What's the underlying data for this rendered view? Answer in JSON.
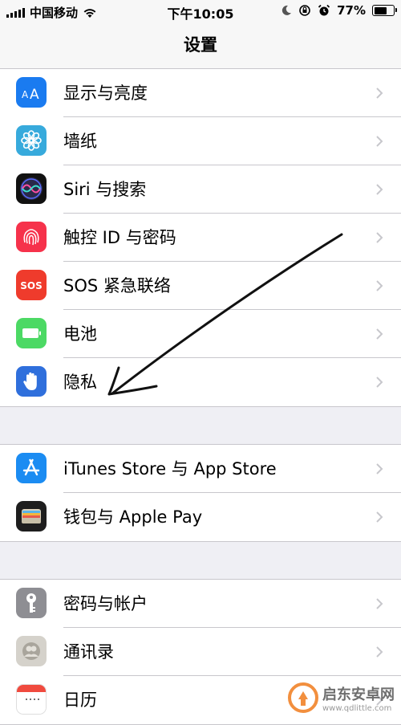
{
  "status_bar": {
    "carrier": "中国移动",
    "time": "下午10:05",
    "battery_percent": "77%",
    "battery_level": 0.77
  },
  "nav": {
    "title": "设置"
  },
  "groups": [
    [
      {
        "label": "显示与亮度",
        "icon": "display-brightness-icon",
        "color": "#1a7bf0"
      },
      {
        "label": "墙纸",
        "icon": "wallpaper-icon",
        "color": "#37aadc"
      },
      {
        "label": "Siri 与搜索",
        "icon": "siri-icon",
        "color": "#1c1c2e"
      },
      {
        "label": "触控 ID 与密码",
        "icon": "fingerprint-icon",
        "color": "#f6324b"
      },
      {
        "label": "SOS 紧急联络",
        "icon": "sos-icon",
        "color": "#ef3b2c",
        "icon_text": "SOS"
      },
      {
        "label": "电池",
        "icon": "battery-icon",
        "color": "#4cd964"
      },
      {
        "label": "隐私",
        "icon": "privacy-hand-icon",
        "color": "#2f6fdc"
      }
    ],
    [
      {
        "label": "iTunes Store 与 App Store",
        "icon": "app-store-icon",
        "color": "#1b8cf2"
      },
      {
        "label": "钱包与 Apple Pay",
        "icon": "wallet-icon",
        "color": "#1e1e1e"
      }
    ],
    [
      {
        "label": "密码与帐户",
        "icon": "key-icon",
        "color": "#8e8e93"
      },
      {
        "label": "通讯录",
        "icon": "contacts-icon",
        "color": "#c9c7c2"
      },
      {
        "label": "日历",
        "icon": "calendar-icon",
        "color": "#ffffff"
      }
    ]
  ],
  "watermark": {
    "brand": "启东安卓网",
    "site": "www.qdlittle.com"
  }
}
